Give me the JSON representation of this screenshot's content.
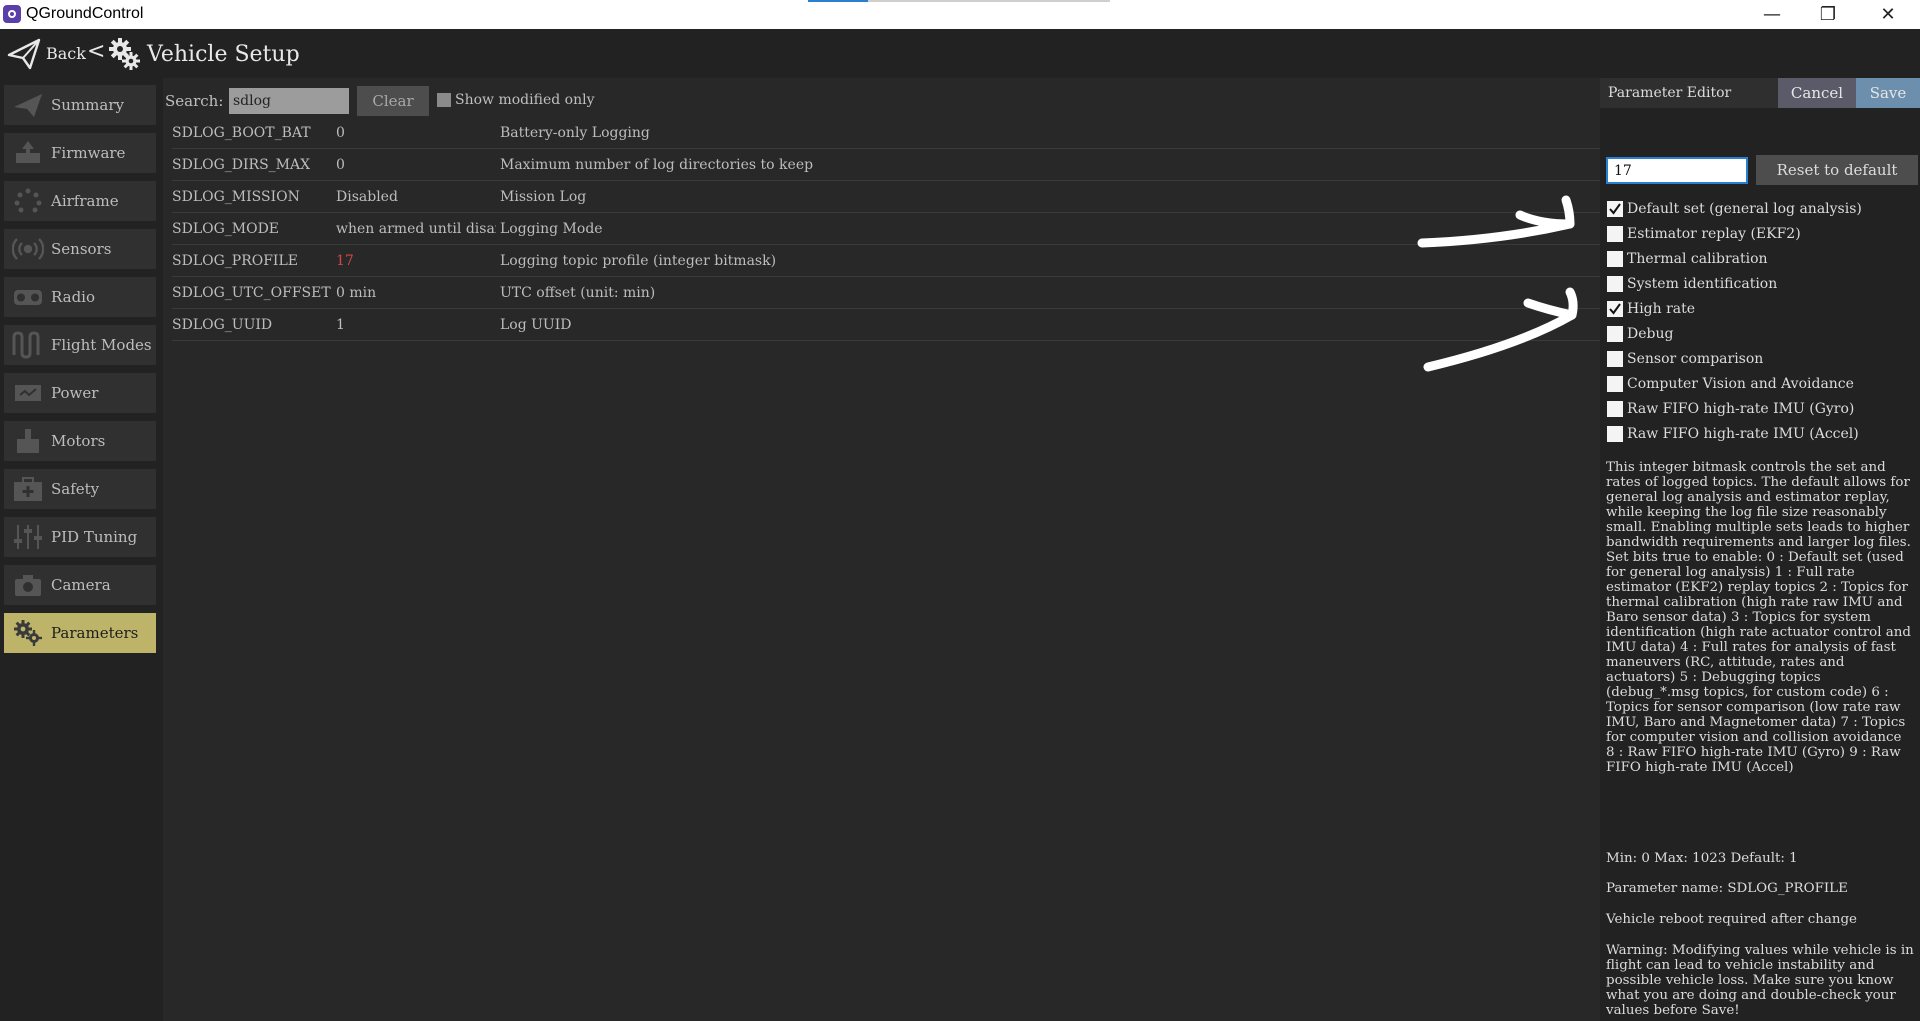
{
  "window": {
    "title": "QGroundControl",
    "minimize_glyph": "—",
    "restore_glyph": "❐",
    "close_glyph": "✕"
  },
  "toolbar": {
    "back_label": "Back",
    "chevron": "<",
    "page_title": "Vehicle Setup"
  },
  "sidebar": {
    "items": [
      {
        "label": "Summary",
        "icon": "plane-icon"
      },
      {
        "label": "Firmware",
        "icon": "firmware-icon"
      },
      {
        "label": "Airframe",
        "icon": "airframe-icon"
      },
      {
        "label": "Sensors",
        "icon": "sensors-icon"
      },
      {
        "label": "Radio",
        "icon": "radio-icon"
      },
      {
        "label": "Flight Modes",
        "icon": "flight-modes-icon"
      },
      {
        "label": "Power",
        "icon": "power-icon"
      },
      {
        "label": "Motors",
        "icon": "motors-icon"
      },
      {
        "label": "Safety",
        "icon": "safety-icon"
      },
      {
        "label": "PID Tuning",
        "icon": "pid-tuning-icon"
      },
      {
        "label": "Camera",
        "icon": "camera-icon"
      },
      {
        "label": "Parameters",
        "icon": "gears-icon",
        "active": true
      }
    ]
  },
  "search": {
    "label": "Search:",
    "value": "sdlog",
    "clear_label": "Clear",
    "show_modified_label": "Show modified only"
  },
  "params": [
    {
      "name": "SDLOG_BOOT_BAT",
      "value": "0",
      "description": "Battery-only Logging"
    },
    {
      "name": "SDLOG_DIRS_MAX",
      "value": "0",
      "description": "Maximum number of log directories to keep"
    },
    {
      "name": "SDLOG_MISSION",
      "value": "Disabled",
      "description": "Mission Log"
    },
    {
      "name": "SDLOG_MODE",
      "value": "when armed until disarm",
      "description": "Logging Mode"
    },
    {
      "name": "SDLOG_PROFILE",
      "value": "17",
      "description": "Logging topic profile (integer bitmask)",
      "modified": true
    },
    {
      "name": "SDLOG_UTC_OFFSET",
      "value": "0 min",
      "description": "UTC offset (unit: min)"
    },
    {
      "name": "SDLOG_UUID",
      "value": "1",
      "description": "Log UUID"
    }
  ],
  "editor": {
    "title": "Parameter Editor",
    "cancel_label": "Cancel",
    "save_label": "Save",
    "value": "17",
    "reset_label": "Reset to default",
    "bits": [
      {
        "label": "Default set (general log analysis)",
        "checked": true
      },
      {
        "label": "Estimator replay (EKF2)",
        "checked": false
      },
      {
        "label": "Thermal calibration",
        "checked": false
      },
      {
        "label": "System identification",
        "checked": false
      },
      {
        "label": "High rate",
        "checked": true
      },
      {
        "label": "Debug",
        "checked": false
      },
      {
        "label": "Sensor comparison",
        "checked": false
      },
      {
        "label": "Computer Vision and Avoidance",
        "checked": false
      },
      {
        "label": "Raw FIFO high-rate IMU (Gyro)",
        "checked": false
      },
      {
        "label": "Raw FIFO high-rate IMU (Accel)",
        "checked": false
      }
    ],
    "help": "This integer bitmask controls the set and rates of logged topics. The default allows for general log analysis and estimator replay, while keeping the log file size reasonably small. Enabling multiple sets leads to higher bandwidth requirements and larger log files. Set bits true to enable: 0 : Default set (used for general log analysis) 1 : Full rate estimator (EKF2) replay topics 2 : Topics for thermal calibration (high rate raw IMU and Baro sensor data) 3 : Topics for system identification (high rate actuator control and IMU data) 4 : Full rates for analysis of fast maneuvers (RC, attitude, rates and actuators) 5 : Debugging topics (debug_*.msg topics, for custom code) 6 : Topics for sensor comparison (low rate raw IMU, Baro and Magnetomer data) 7 : Topics for computer vision and collision avoidance 8 : Raw FIFO high-rate IMU (Gyro) 9 : Raw FIFO high-rate IMU (Accel)",
    "range": "Min: 0 Max: 1023 Default: 1",
    "param_name": "Parameter name: SDLOG_PROFILE",
    "reboot": "Vehicle reboot required after change",
    "warning": "Warning: Modifying values while vehicle is in flight can lead to vehicle instability and possible vehicle loss. Make sure you know what you are doing and double-check your values before Save!"
  },
  "colors": {
    "active_tab": "#bdb46a",
    "modified_value": "#d24848",
    "save_button": "#6d8fae"
  }
}
